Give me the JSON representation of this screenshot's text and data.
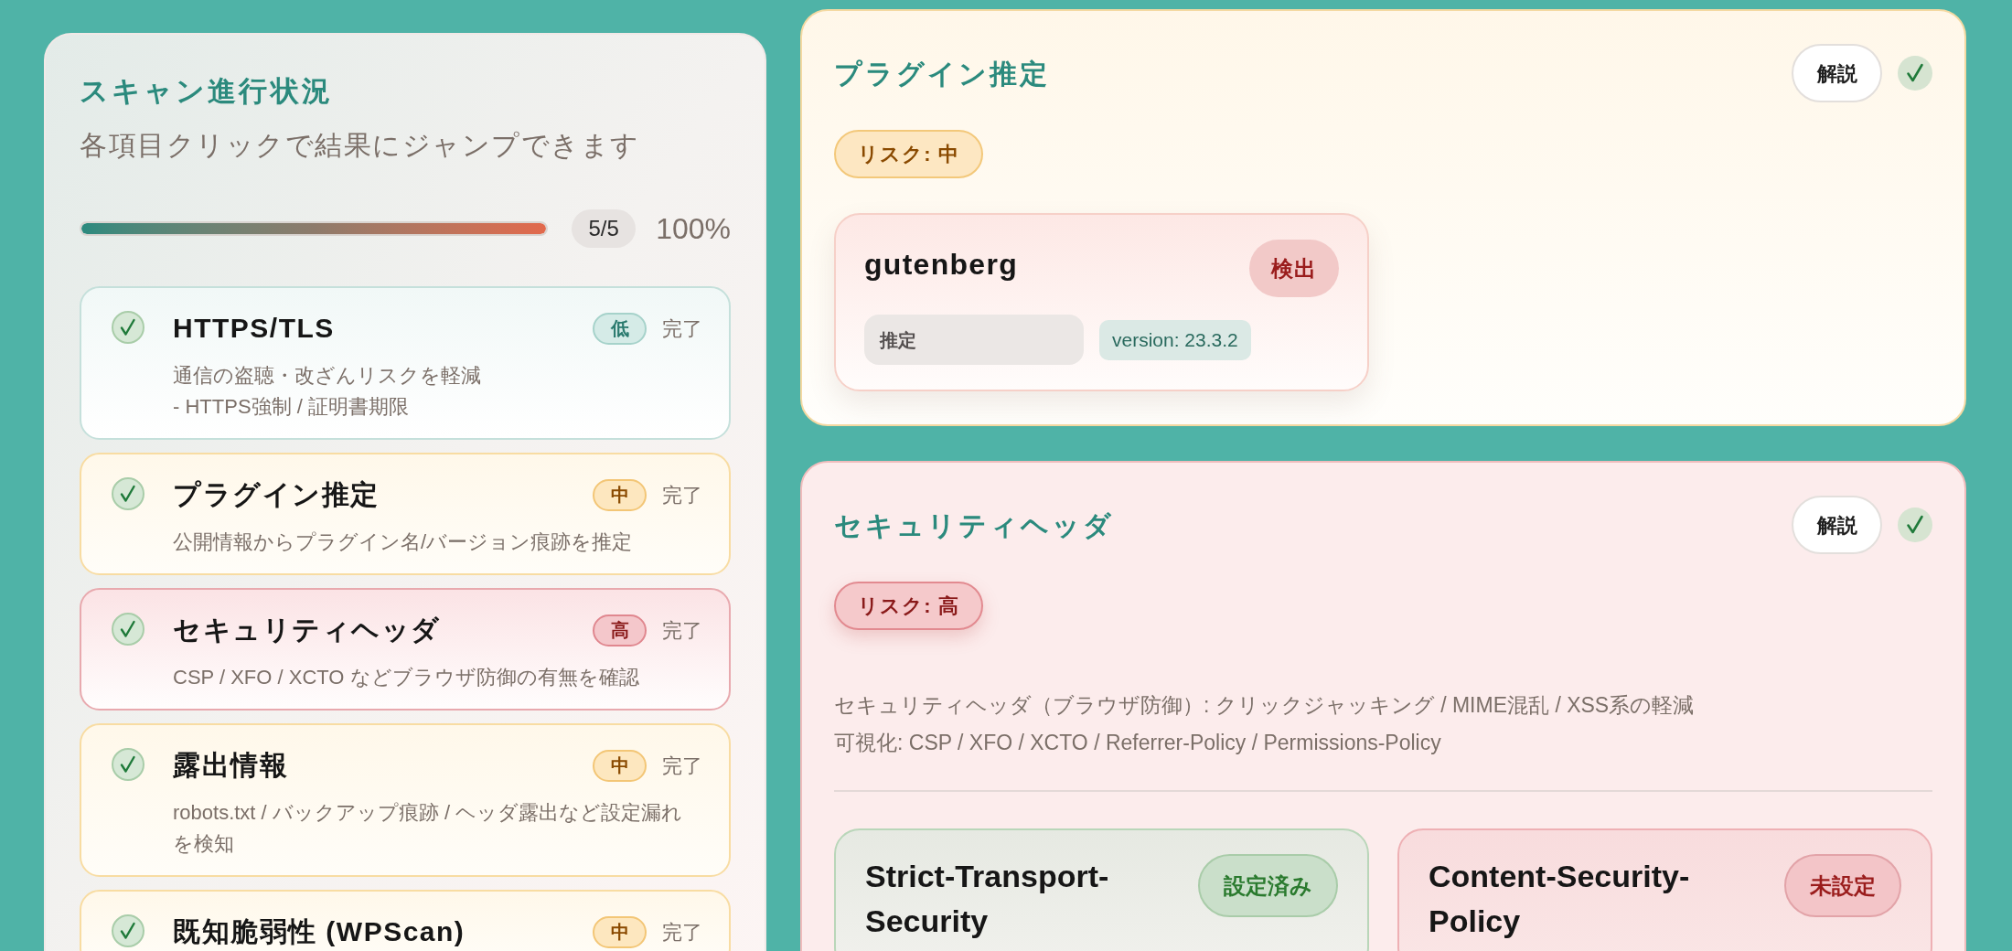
{
  "progress_panel": {
    "title": "スキャン進行状況",
    "subtitle": "各項目クリックで結果にジャンプできます",
    "progress": {
      "level": 1,
      "count": "5/5",
      "percent": "100%"
    },
    "items": [
      {
        "title": "HTTPS/TLS",
        "kind": "low",
        "risk": "低",
        "status": "完了",
        "done": true,
        "description": "通信の盗聴・改ざんリスクを軽減\n- HTTPS強制 / 証明書期限"
      },
      {
        "title": "プラグイン推定",
        "kind": "medium",
        "risk": "中",
        "status": "完了",
        "done": true,
        "description": "公開情報からプラグイン名/バージョン痕跡を推定"
      },
      {
        "title": "セキュリティヘッダ",
        "kind": "high",
        "risk": "高",
        "status": "完了",
        "done": true,
        "description": "CSP / XFO / XCTO などブラウザ防御の有無を確認"
      },
      {
        "title": "露出情報",
        "kind": "medium",
        "risk": "中",
        "status": "完了",
        "done": true,
        "description": "robots.txt / バックアップ痕跡 / ヘッダ露出など設定漏れを検知"
      },
      {
        "title": "既知脆弱性 (WPScan)",
        "kind": "medium",
        "risk": "中",
        "status": "完了",
        "done": true
      }
    ]
  },
  "sections": [
    {
      "kind": "plugins",
      "title": "プラグイン推定",
      "explain_button": "解説",
      "done": true,
      "risk": {
        "label": "リスク: 中",
        "kind": "medium"
      },
      "plugins": [
        {
          "name": "gutenberg",
          "status": "検出",
          "method": "推定",
          "version": "version: 23.3.2"
        }
      ]
    },
    {
      "kind": "headers",
      "title": "セキュリティヘッダ",
      "explain_button": "解説",
      "done": true,
      "risk": {
        "label": "リスク: 高",
        "kind": "high"
      },
      "notes": [
        "セキュリティヘッダ（ブラウザ防御）: クリックジャッキング / MIME混乱 / XSS系の軽減",
        "可視化: CSP / XFO / XCTO / Referrer-Policy / Permissions-Policy"
      ],
      "headers": [
        {
          "name": "Strict-Transport-Security",
          "status": "設定済み",
          "set": true
        },
        {
          "name": "Content-Security-Policy",
          "status": "未設定",
          "set": false
        }
      ]
    }
  ]
}
